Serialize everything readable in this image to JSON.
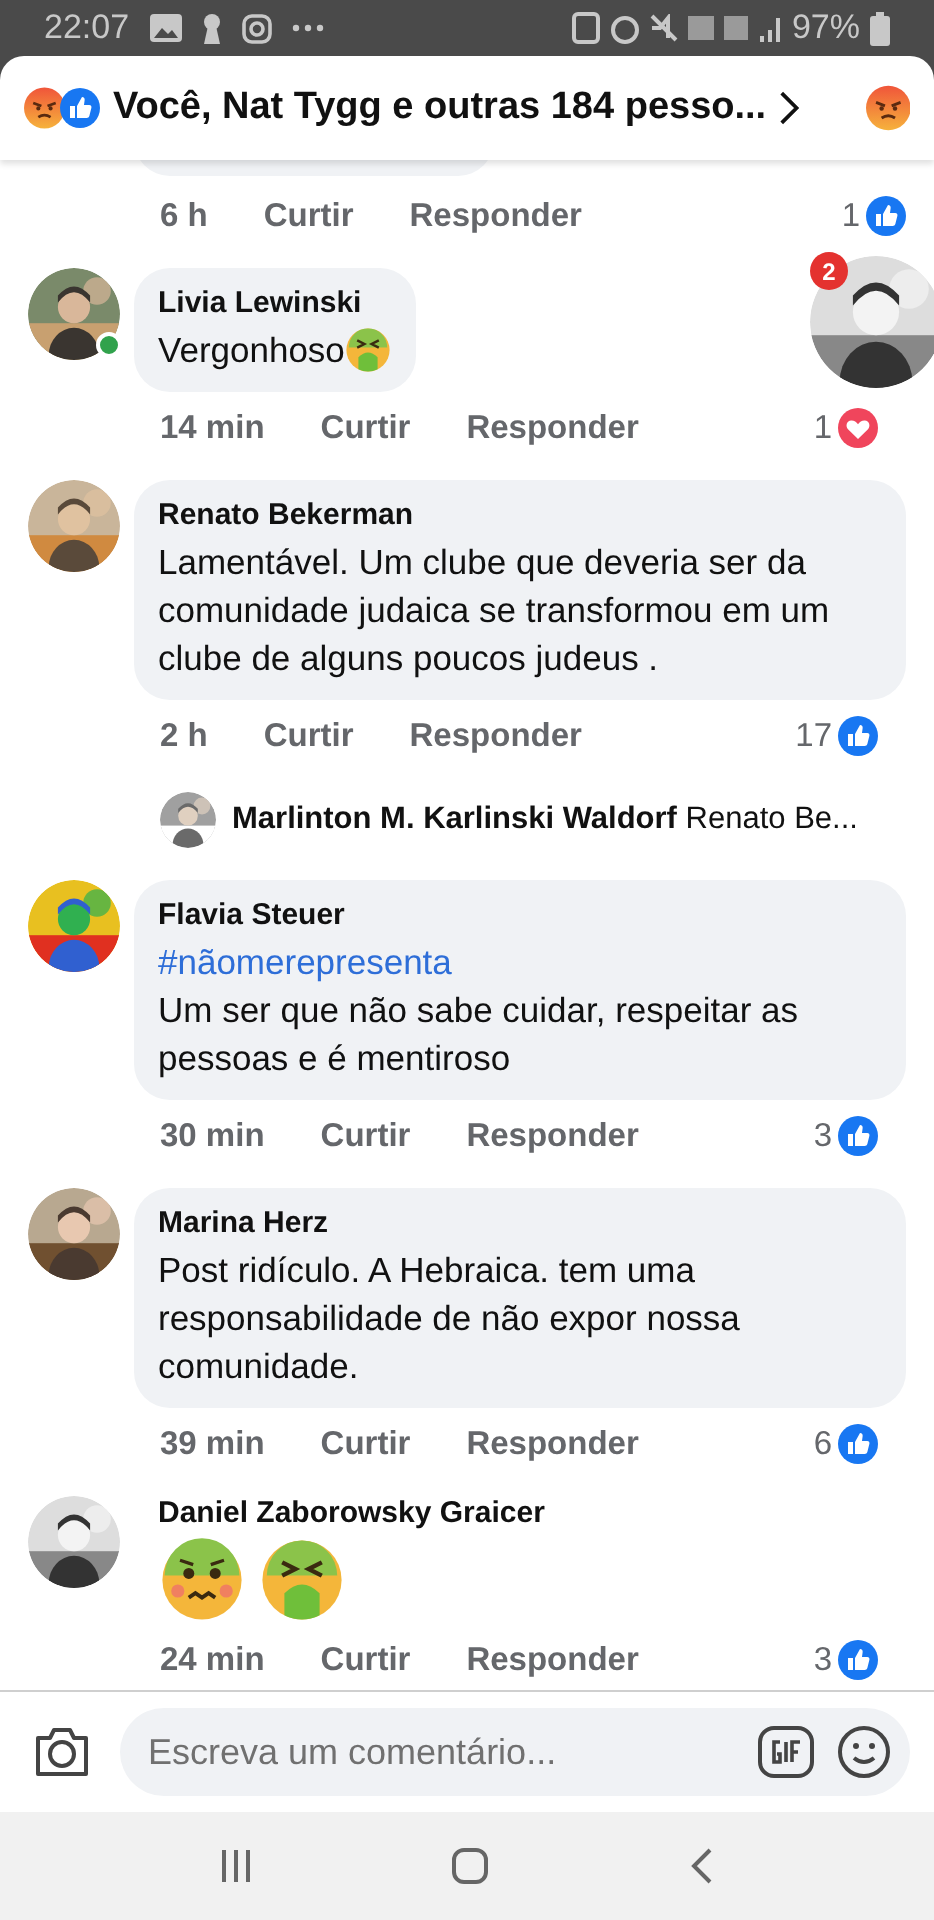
{
  "status_bar": {
    "time": "22:07",
    "battery": "97%"
  },
  "header": {
    "title": "Você, Nat Tygg e outras 184 pesso..."
  },
  "partial_comment": {
    "time": "6 h",
    "like_label": "Curtir",
    "reply_label": "Responder",
    "reaction_count": "1",
    "loved": false
  },
  "chat_head": {
    "badge": "2"
  },
  "comments": [
    {
      "kind": "text_with_emoji",
      "author": "Livia Lewinski",
      "online": true,
      "text": "Vergonhoso",
      "time": "14 min",
      "like_label": "Curtir",
      "reply_label": "Responder",
      "reaction_count": "1",
      "loved": true
    },
    {
      "kind": "comment",
      "author": "Renato Bekerman",
      "online": false,
      "text": "Lamentável. Um clube que deveria ser da comunidade judaica se transformou em um clube de alguns poucos judeus .",
      "time": "2 h",
      "like_label": "Curtir",
      "reply_label": "Responder",
      "reaction_count": "17",
      "loved": false
    },
    {
      "kind": "reply_preview",
      "author": "Marlinton M. Karlinski Waldorf",
      "text": "Renato Be..."
    },
    {
      "kind": "comment",
      "author": "Flavia Steuer",
      "online": false,
      "hashtag": "#nãomerepresenta",
      "text": "Um ser que não sabe cuidar, respeitar as pessoas e é mentiroso",
      "time": "30 min",
      "like_label": "Curtir",
      "reply_label": "Responder",
      "reaction_count": "3",
      "loved": false
    },
    {
      "kind": "comment",
      "author": "Marina Herz",
      "online": false,
      "text": "Post ridículo.  A Hebraica. tem uma responsabilidade de não expor nossa comunidade.",
      "time": "39 min",
      "like_label": "Curtir",
      "reply_label": "Responder",
      "reaction_count": "6",
      "loved": false
    },
    {
      "kind": "emoji_pair",
      "author": "Daniel Zaborowsky Graicer",
      "online": false,
      "time": "24 min",
      "like_label": "Curtir",
      "reply_label": "Responder",
      "reaction_count": "3",
      "loved": false
    }
  ],
  "composer": {
    "placeholder": "Escreva um comentário..."
  }
}
